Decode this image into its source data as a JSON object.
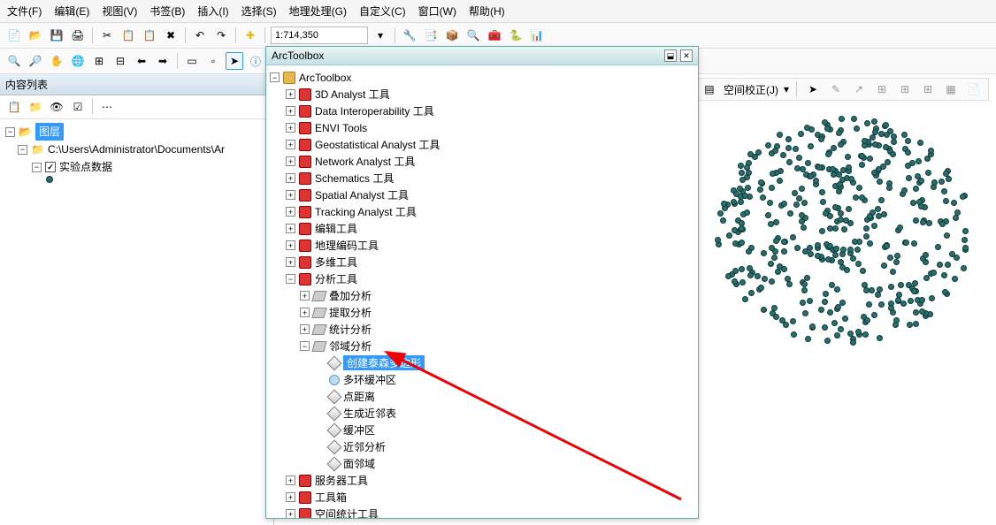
{
  "menu": {
    "file": "文件(F)",
    "edit": "编辑(E)",
    "view": "视图(V)",
    "bookmark": "书签(B)",
    "insert": "插入(I)",
    "select": "选择(S)",
    "geo": "地理处理(G)",
    "custom": "自定义(C)",
    "window": "窗口(W)",
    "help": "帮助(H)"
  },
  "toolbar": {
    "scale": "1:714,350",
    "spatial_label": "空间校正(J)"
  },
  "toc": {
    "title": "内容列表",
    "root": "图层",
    "path": "C:\\Users\\Administrator\\Documents\\Ar",
    "layer": "实验点数据"
  },
  "arctoolbox": {
    "title": "ArcToolbox",
    "root": "ArcToolbox",
    "toolboxes": [
      "3D Analyst 工具",
      "Data Interoperability 工具",
      "ENVI Tools",
      "Geostatistical Analyst 工具",
      "Network Analyst 工具",
      "Schematics 工具",
      "Spatial Analyst 工具",
      "Tracking Analyst 工具",
      "编辑工具",
      "地理编码工具",
      "多维工具"
    ],
    "analysis": "分析工具",
    "analysis_sets": [
      "叠加分析",
      "提取分析",
      "统计分析"
    ],
    "proximity": "邻域分析",
    "proximity_tools": [
      "创建泰森多边形",
      "多环缓冲区",
      "点距离",
      "生成近邻表",
      "缓冲区",
      "近邻分析",
      "面邻域"
    ],
    "toolboxes_after": [
      "服务器工具",
      "工具箱",
      "空间统计工具"
    ]
  }
}
